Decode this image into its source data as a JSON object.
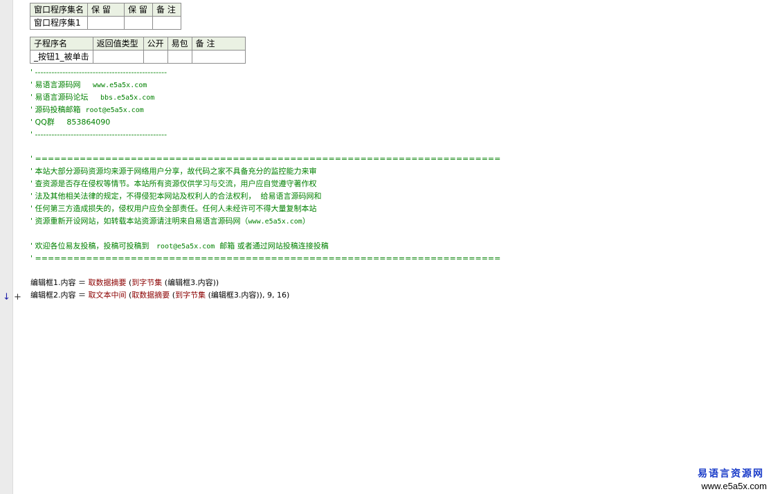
{
  "assembly_table": {
    "headers": [
      "窗口程序集名",
      "保 留",
      "保 留",
      "备 注"
    ],
    "row": [
      "窗口程序集1",
      "",
      "",
      ""
    ]
  },
  "sub_table": {
    "headers": [
      "子程序名",
      "返回值类型",
      "公开",
      "易包",
      "备 注"
    ],
    "row": [
      "_按钮1_被单击",
      "",
      "",
      "",
      ""
    ]
  },
  "code": {
    "lines": [
      {
        "parts": [
          {
            "c": "comment",
            "t": "' ------------------------------------------------"
          }
        ]
      },
      {
        "parts": [
          {
            "c": "comment",
            "t": "' 易语言源码网     "
          },
          {
            "c": "comment mono",
            "t": "www.e5a5x.com"
          }
        ]
      },
      {
        "parts": [
          {
            "c": "comment",
            "t": "' 易语言源码论坛     "
          },
          {
            "c": "comment mono",
            "t": "bbs.e5a5x.com"
          }
        ]
      },
      {
        "parts": [
          {
            "c": "comment",
            "t": "' 源码投稿邮箱  "
          },
          {
            "c": "comment mono",
            "t": "root@e5a5x.com"
          }
        ]
      },
      {
        "parts": [
          {
            "c": "comment",
            "t": "' QQ群     853864090"
          }
        ]
      },
      {
        "parts": [
          {
            "c": "comment",
            "t": "' ------------------------------------------------"
          }
        ]
      },
      {
        "parts": []
      },
      {
        "parts": [
          {
            "c": "comment",
            "t": "' ========================================================================="
          }
        ]
      },
      {
        "parts": [
          {
            "c": "comment",
            "t": "' 本站大部分源码资源均来源于网络用户分享，故代码之家不具备充分的监控能力来审"
          }
        ]
      },
      {
        "parts": [
          {
            "c": "comment",
            "t": "' 查资源是否存在侵权等情节。本站所有资源仅供学习与交流，用户应自觉遵守著作权"
          }
        ]
      },
      {
        "parts": [
          {
            "c": "comment",
            "t": "' 法及其他相关法律的规定，不得侵犯本网站及权利人的合法权利，  给易语言源码网和"
          }
        ]
      },
      {
        "parts": [
          {
            "c": "comment",
            "t": "' 任何第三方造成损失的，侵权用户应负全部责任。任何人未经许可不得大量复制本站"
          }
        ]
      },
      {
        "parts": [
          {
            "c": "comment",
            "t": "' 资源重新开设网站，如转载本站资源请注明来自易语言源码网（"
          },
          {
            "c": "comment mono",
            "t": "www.e5a5x.com"
          },
          {
            "c": "comment",
            "t": "）"
          }
        ]
      },
      {
        "parts": []
      },
      {
        "parts": [
          {
            "c": "comment",
            "t": "' 欢迎各位易友投稿，投稿可投稿到   "
          },
          {
            "c": "comment mono",
            "t": "root@e5a5x.com"
          },
          {
            "c": "comment",
            "t": "  邮箱 或者通过网站投稿连接投稿"
          }
        ]
      },
      {
        "parts": [
          {
            "c": "comment",
            "t": "' ========================================================================="
          }
        ]
      },
      {
        "parts": []
      },
      {
        "parts": [
          {
            "c": "kw",
            "t": "编辑框1.内容 ＝ "
          },
          {
            "c": "fn",
            "t": "取数据摘要"
          },
          {
            "c": "kw",
            "t": " ("
          },
          {
            "c": "fn",
            "t": "到字节集"
          },
          {
            "c": "kw",
            "t": " (编辑框3.内容))"
          }
        ]
      },
      {
        "parts": [
          {
            "c": "kw",
            "t": "编辑框2.内容 ＝ "
          },
          {
            "c": "fn",
            "t": "取文本中间"
          },
          {
            "c": "kw",
            "t": " ("
          },
          {
            "c": "fn",
            "t": "取数据摘要"
          },
          {
            "c": "kw",
            "t": " ("
          },
          {
            "c": "fn",
            "t": "到字节集"
          },
          {
            "c": "kw",
            "t": " (编辑框3.内容)), 9, 16)"
          }
        ]
      }
    ]
  },
  "gutter_markers": {
    "arrow": "↓",
    "plus": "+"
  },
  "watermark": {
    "title": "易语言资源网",
    "url": "www.e5a5x.com"
  }
}
